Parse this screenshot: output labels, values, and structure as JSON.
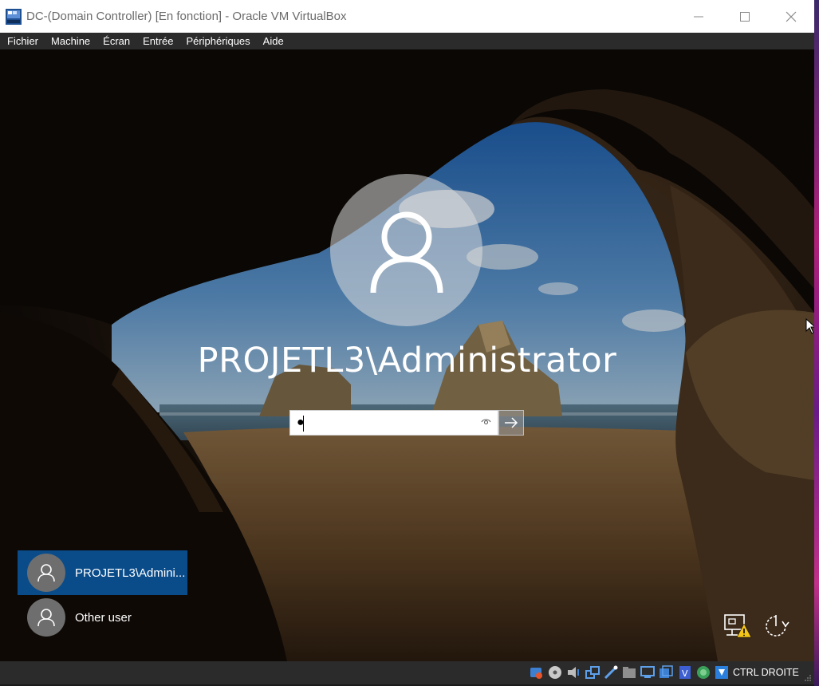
{
  "window": {
    "title": "DC-(Domain Controller) [En fonction] - Oracle VM VirtualBox",
    "app_icon": "virtualbox-vm-icon",
    "controls": [
      "minimize-icon",
      "maximize-icon",
      "close-icon"
    ]
  },
  "menubar": {
    "items": [
      "Fichier",
      "Machine",
      "Écran",
      "Entrée",
      "Périphériques",
      "Aide"
    ]
  },
  "lockscreen": {
    "username": "PROJETL3\\Administrator",
    "password_value": "●",
    "reveal_icon": "eye-icon",
    "submit_icon": "arrow-right-icon",
    "users": [
      {
        "label": "PROJETL3\\Admini...",
        "selected": true
      },
      {
        "label": "Other user",
        "selected": false
      }
    ],
    "corner_icons": [
      "network-warning-icon",
      "power-icon"
    ]
  },
  "statusbar": {
    "icons": [
      "hard-disk-icon",
      "optical-drive-icon",
      "audio-icon",
      "network-icon",
      "usb-icon",
      "shared-folders-icon",
      "display-icon",
      "video-capture-icon",
      "virtualization-icon",
      "mouse-integration-icon",
      "keyboard-capture-icon"
    ],
    "host_key": "CTRL DROITE"
  },
  "colors": {
    "selected_tile": "#0a4c8a",
    "titlebar": "#ffffff",
    "menubar": "#2b2b2b"
  }
}
